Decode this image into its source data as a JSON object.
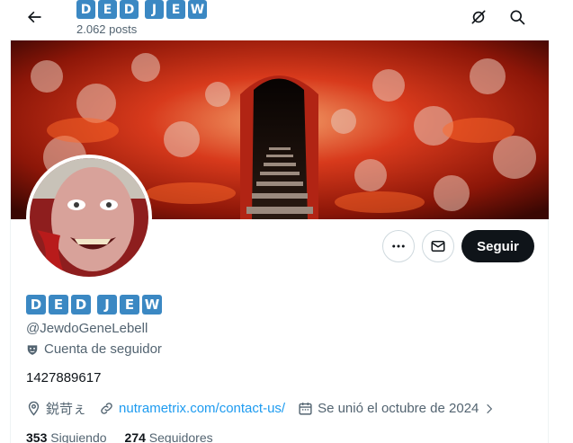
{
  "header": {
    "name_tiles": [
      "D",
      "E",
      "D",
      "J",
      "E",
      "W"
    ],
    "post_count": "2.062 posts"
  },
  "profile": {
    "name_tiles": [
      "D",
      "E",
      "D",
      "J",
      "E",
      "W"
    ],
    "handle": "@JewdoGeneLebell",
    "follower_tag": "Cuenta de seguidor",
    "bio": "1427889617",
    "location": "鋭苛ぇ",
    "website": "nutrametrix.com/contact-us/",
    "joined": "Se unió el octubre de 2024"
  },
  "actions": {
    "follow_label": "Seguir"
  },
  "stats": {
    "following_count": "353",
    "following_label": "Siguiendo",
    "followers_count": "274",
    "followers_label": "Seguidores"
  },
  "icons": {
    "back": "back-arrow-icon",
    "grok": "grok-icon",
    "search": "search-icon",
    "more": "more-icon",
    "message": "message-icon",
    "follower_tag": "mask-icon",
    "location": "location-icon",
    "link": "link-icon",
    "calendar": "calendar-icon",
    "expand": "chevron-right-icon"
  },
  "colors": {
    "tile_blue": "#3b88c3",
    "link_blue": "#1d9bf0",
    "follow_button": "#0f1419",
    "secondary_text": "#536471"
  }
}
